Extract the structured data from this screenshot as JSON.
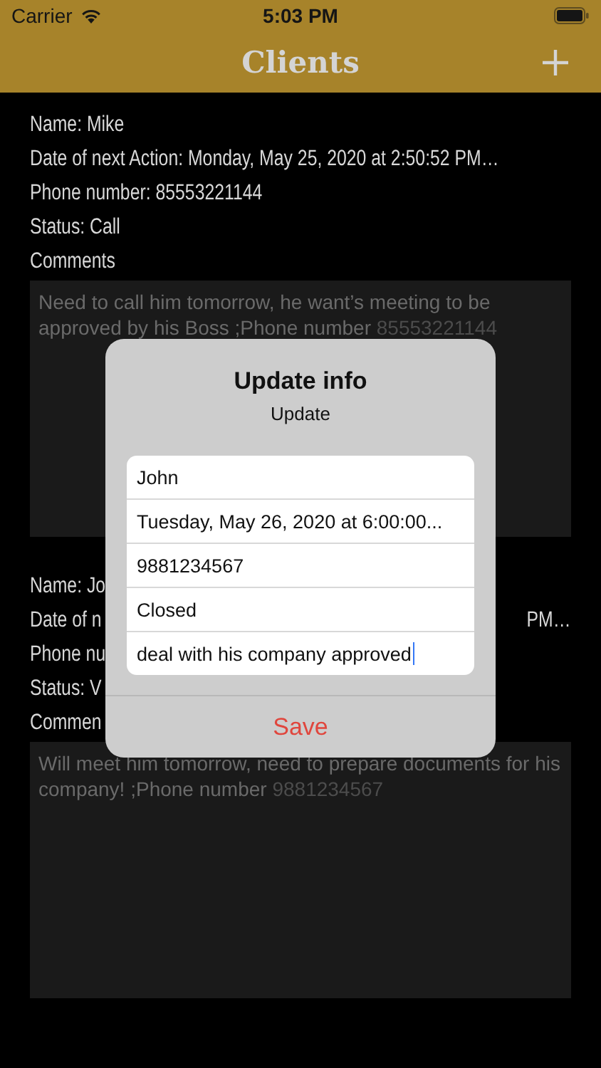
{
  "status_bar": {
    "carrier": "Carrier",
    "time": "5:03 PM"
  },
  "nav_bar": {
    "title": "Clients"
  },
  "clients": [
    {
      "lines": [
        {
          "text": "Name: Mike"
        },
        {
          "text": "Date of next Action: Monday, May 25, 2020 at 2:50:52 PM…"
        },
        {
          "text": "Phone number: 85553221144"
        },
        {
          "text": "Status: Call"
        }
      ],
      "comments_label": "Comments",
      "comment": {
        "text": "Need to call him tomorrow, he want’s meeting to be approved by his Boss ;Phone number",
        "phone": "85553221144"
      }
    },
    {
      "lines": [
        {
          "text": "Name: Jo"
        },
        {
          "text": "Date of n",
          "tail": "PM…"
        },
        {
          "text": "Phone nu"
        },
        {
          "text": "Status: V"
        }
      ],
      "comments_label": "Commen",
      "comment": {
        "text": "Will meet him tomorrow, need to prepare documents for his company! ;Phone number",
        "phone": "9881234567"
      }
    }
  ],
  "alert": {
    "title": "Update info",
    "message": "Update",
    "fields": [
      {
        "value": "John",
        "focused": false
      },
      {
        "value": "Tuesday, May 26, 2020 at 6:00:00...",
        "focused": false
      },
      {
        "value": "9881234567",
        "focused": false
      },
      {
        "value": "Closed",
        "focused": false
      },
      {
        "value": "deal with his company approved",
        "focused": true
      }
    ],
    "action": "Save"
  }
}
